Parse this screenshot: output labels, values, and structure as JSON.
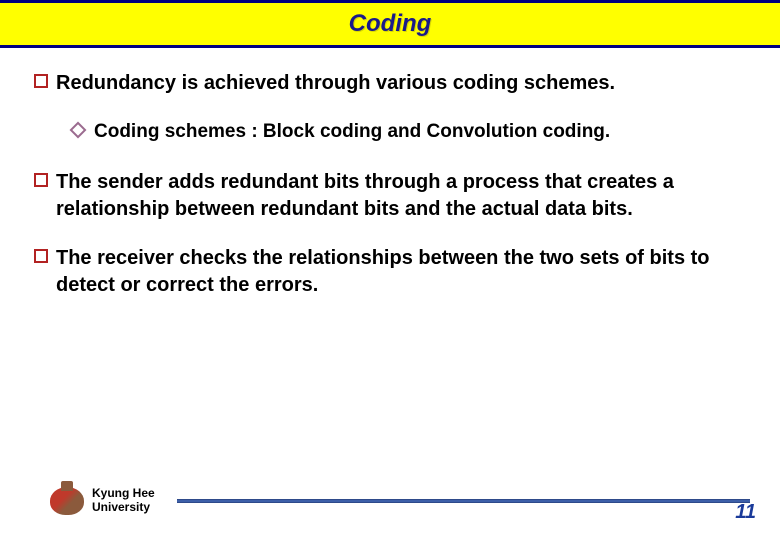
{
  "title": "Coding",
  "bullets": [
    {
      "type": "main",
      "text": "Redundancy is achieved through various coding schemes."
    },
    {
      "type": "sub",
      "text": "Coding schemes : Block coding and Convolution coding."
    },
    {
      "type": "main",
      "text": "The sender adds redundant bits through a process that creates a relationship between redundant bits and the actual data bits."
    },
    {
      "type": "main",
      "text": "The receiver checks the relationships between the two sets of bits to detect or correct the errors."
    }
  ],
  "footer": {
    "university_line1": "Kyung Hee",
    "university_line2": "University",
    "page_number": "11"
  }
}
